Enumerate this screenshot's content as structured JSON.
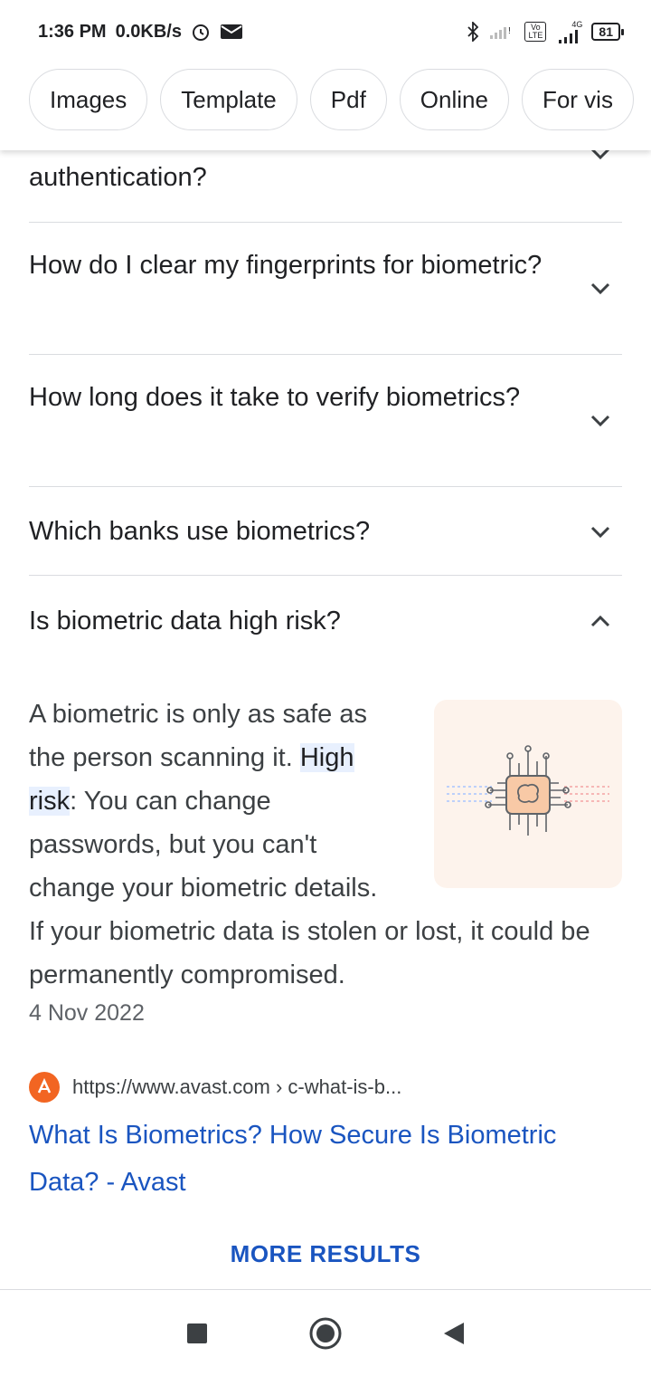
{
  "status_bar": {
    "time": "1:36 PM",
    "net_speed": "0.0KB/s",
    "battery": "81",
    "network_label": "4G",
    "volte": "Vo LTE",
    "icons": [
      "alarm-icon",
      "mail-icon",
      "bluetooth-icon",
      "signal-icon"
    ]
  },
  "chips": [
    "Images",
    "Template",
    "Pdf",
    "Online",
    "For vis"
  ],
  "faq": [
    {
      "question": "authentication?",
      "expanded": false
    },
    {
      "question": "How do I clear my fingerprints for biometric?",
      "expanded": false
    },
    {
      "question": "How long does it take to verify biometrics?",
      "expanded": false
    },
    {
      "question": "Which banks use biometrics?",
      "expanded": false
    },
    {
      "question": "Is biometric data high risk?",
      "expanded": true
    }
  ],
  "answer": {
    "text_before": "A biometric is only as safe as the person scanning it. ",
    "highlight": "High risk",
    "text_after": ": You can change passwords, but you can't change your biometric details. If your biometric data is stolen or lost, it could be permanently compromised.",
    "date": "4 Nov 2022",
    "source_url": "https://www.avast.com › c-what-is-b...",
    "link_title": "What Is Biometrics? How Secure Is Biometric Data? - Avast"
  },
  "more_results": "MORE RESULTS",
  "colors": {
    "link": "#1a55c0",
    "highlight_bg": "#e8f0fe",
    "favicon": "#f26522"
  }
}
